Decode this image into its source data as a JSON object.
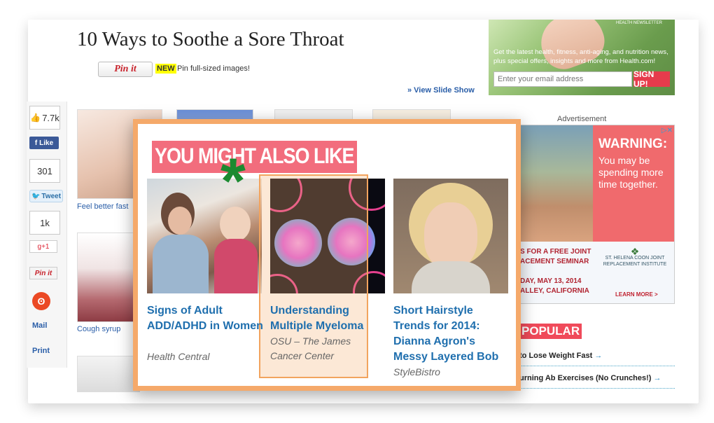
{
  "article": {
    "title": "10 Ways to Soothe a Sore Throat",
    "pin_label": "Pin it",
    "new_badge": "NEW",
    "pin_text": "Pin full-sized images!",
    "view_slideshow": "» View Slide Show",
    "thumbnails": [
      {
        "caption": "Feel better fast"
      },
      {
        "caption": "Cough syrup"
      }
    ]
  },
  "social": {
    "fb_count": "7.7k",
    "fb_like": "Like",
    "tweet_count": "301",
    "tweet": "Tweet",
    "gplus_count": "1k",
    "gplus": "g+1",
    "pin": "Pin it",
    "mail": "Mail",
    "print": "Print"
  },
  "newsletter": {
    "label": "HEALTH NEWSLETTER",
    "text": "Get the latest health, fitness, anti-aging, and nutrition news, plus special offers, insights and more from Health.com!",
    "email_placeholder": "Enter your email address",
    "signup": "SIGN UP!"
  },
  "ad": {
    "label": "Advertisement",
    "warning": "WARNING:",
    "warning_sub": "You may be spending more time together.",
    "seminar": "S FOR A FREE JOINT\nACEMENT SEMINAR\n\nDAY, MAY 13, 2014\nALLEY, CALIFORNIA",
    "logo": "ST. HELENA COON JOINT REPLACEMENT INSTITUTE",
    "learn_more": "LEARN MORE >"
  },
  "popular": {
    "heading": "POPULAR",
    "items": [
      "to Lose Weight Fast",
      "urning Ab Exercises (No Crunches!)"
    ]
  },
  "overlay": {
    "heading": "YOU MIGHT ALSO LIKE",
    "cards": [
      {
        "title": "Signs of Adult ADD/ADHD in Women",
        "source": "Health Central"
      },
      {
        "title": "Understanding Multiple Myeloma",
        "source": "OSU – The James Cancer Center"
      },
      {
        "title": "Short Hairstyle Trends for 2014: Dianna Agron's Messy Layered Bob",
        "source": "StyleBistro"
      }
    ]
  },
  "colors": {
    "overlay_border": "#f5a96a",
    "heading_bg": "#f26d7d",
    "link_blue": "#1f6fae",
    "asterisk_green": "#1b8a30"
  }
}
